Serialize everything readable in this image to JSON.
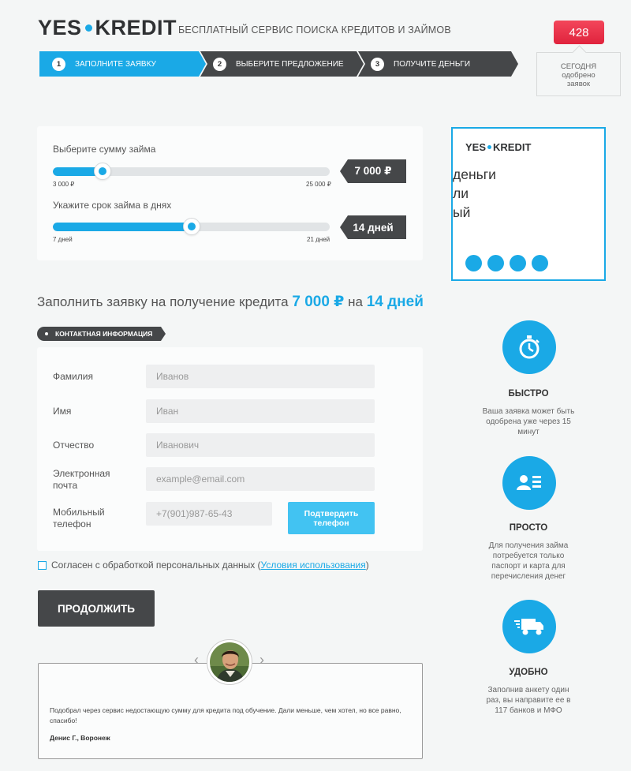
{
  "header": {
    "logo_left": "YES",
    "logo_right": "KREDIT",
    "tagline": "БЕСПЛАТНЫЙ СЕРВИС ПОИСКА КРЕДИТОВ И ЗАЙМОВ",
    "counter": "428",
    "counter_note": "СЕГОДНЯ одобрено заявок"
  },
  "steps": [
    {
      "num": "1",
      "label": "ЗАПОЛНИТЕ ЗАЯВКУ",
      "active": true
    },
    {
      "num": "2",
      "label": "ВЫБЕРИТЕ ПРЕДЛОЖЕНИЕ",
      "active": false
    },
    {
      "num": "3",
      "label": "ПОЛУЧИТЕ ДЕНЬГИ",
      "active": false
    }
  ],
  "sliders": {
    "amount": {
      "label": "Выберите сумму займа",
      "min": "3 000 ₽",
      "max": "25 000 ₽",
      "value": "7 000 ₽",
      "fraction": 0.18
    },
    "term": {
      "label": "Укажите срок займа в днях",
      "min": "7 дней",
      "max": "21 дней",
      "value": "14 дней",
      "fraction": 0.5
    }
  },
  "banner": {
    "logo_left": "YES",
    "logo_right": "KREDIT",
    "lines": [
      "деньги",
      "ли",
      "ый"
    ]
  },
  "form": {
    "title_prefix": "Заполнить заявку на получение кредита",
    "title_amount": "7 000 ₽",
    "title_mid": "на",
    "title_days": "14 дней",
    "section": "КОНТАКТНАЯ ИНФОРМАЦИЯ",
    "fields": {
      "last_name": {
        "label": "Фамилия",
        "placeholder": "Иванов"
      },
      "first_name": {
        "label": "Имя",
        "placeholder": "Иван"
      },
      "middle_name": {
        "label": "Отчество",
        "placeholder": "Иванович"
      },
      "email": {
        "label": "Электронная почта",
        "placeholder": "example@email.com"
      },
      "phone": {
        "label": "Мобильный телефон",
        "placeholder": "+7(901)987-65-43"
      }
    },
    "confirm_phone": "Подтвердить телефон",
    "agree_text": "Согласен с обработкой персональных данных (",
    "agree_link": "Условия использования",
    "agree_close": ")",
    "continue": "ПРОДОЛЖИТЬ"
  },
  "review": {
    "text": "Подобрал через сервис недостающую сумму для кредита под обучение. Дали меньше, чем хотел, но все равно, спасибо!",
    "author": "Денис Г., Воронеж",
    "prev": "‹",
    "next": "›"
  },
  "features": [
    {
      "icon": "stopwatch-icon",
      "title": "БЫСТРО",
      "text": "Ваша заявка может быть одобрена уже через 15 минут"
    },
    {
      "icon": "id-card-icon",
      "title": "ПРОСТО",
      "text": "Для получения займа потребуется только паспорт и карта для перечисления денег"
    },
    {
      "icon": "delivery-truck-icon",
      "title": "УДОБНО",
      "text": "Заполнив анкету один раз, вы направите ее в 117 банков и МФО"
    }
  ],
  "colors": {
    "accent": "#1aa9e6",
    "dark": "#454749",
    "counter": "#e8304a"
  }
}
